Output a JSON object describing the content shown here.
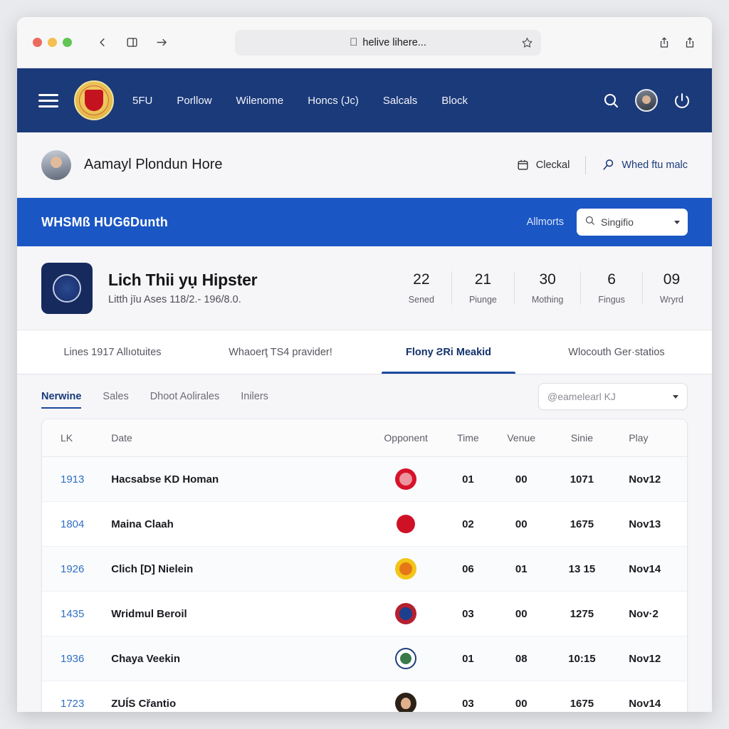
{
  "browser": {
    "url_text": "helive lihere...",
    "apple_glyph": "",
    "icons": {
      "back": "back-arrow-icon",
      "sidebar": "sidebar-toggle-icon",
      "forward": "forward-arrow-icon",
      "bookmark": "star-icon",
      "share": "share-icon",
      "tabs": "new-tab-icon"
    }
  },
  "navbar": {
    "brand": "club-crest",
    "links": [
      "5FU",
      "Porllow",
      "Wilenome",
      "Honcs (Jc)",
      "Salcals",
      "Block"
    ],
    "actions": {
      "search": "search-icon",
      "avatar": "user-avatar",
      "power": "power-icon"
    }
  },
  "profile": {
    "name": "Aamayl Plondun Hore",
    "actions": [
      {
        "label": "Cleckal",
        "icon": "calendar-icon"
      },
      {
        "label": "Whed ftu malc",
        "icon": "search-plus-icon"
      }
    ]
  },
  "bluebar": {
    "title": "WHSMß HUG6Dunth",
    "link": "Allmorts",
    "search": {
      "value": "Singifio",
      "icon": "search-icon"
    }
  },
  "hero": {
    "title": "Lich Thii yụ Hipster",
    "subtitle": "Litth jīu Ases 118/2.- 196/8.0.",
    "stats": [
      {
        "value": "22",
        "label": "Sened"
      },
      {
        "value": "21",
        "label": "Piunge"
      },
      {
        "value": "30",
        "label": "Mothing"
      },
      {
        "value": "6",
        "label": "Fingus"
      },
      {
        "value": "09",
        "label": "Wryrd"
      }
    ]
  },
  "main_tabs": [
    {
      "label": "Lines 1917 Allıotuites",
      "active": false
    },
    {
      "label": "Whaoerţ TS4 pravider!",
      "active": false
    },
    {
      "label": "Flony ƧRi Meakid",
      "active": true
    },
    {
      "label": "Wlocouth Ger·statios",
      "active": false
    }
  ],
  "sub_tabs": [
    {
      "label": "Nerwine",
      "active": true
    },
    {
      "label": "Sales",
      "active": false
    },
    {
      "label": "Dhoot Aolirales",
      "active": false
    },
    {
      "label": "Inilers",
      "active": false
    }
  ],
  "sub_select": {
    "value": "@eamelearl KJ"
  },
  "table": {
    "columns": [
      "LK",
      "Date",
      "Opponent",
      "Time",
      "Venue",
      "Sinie",
      "Play"
    ],
    "rows": [
      {
        "lk": "1913",
        "date": "Hacsabse KD Homan",
        "badge": "b1",
        "time": "01",
        "venue": "00",
        "sinie": "1071",
        "play": "Nov12"
      },
      {
        "lk": "1804",
        "date": "Maina Claah",
        "badge": "b2",
        "time": "02",
        "venue": "00",
        "sinie": "1675",
        "play": "Nov13"
      },
      {
        "lk": "1926",
        "date": "Clich [D] Nielein",
        "badge": "b3",
        "time": "06",
        "venue": "01",
        "sinie": "13 15",
        "play": "Nov14"
      },
      {
        "lk": "1435",
        "date": "Wridmul Beroil",
        "badge": "b4",
        "time": "03",
        "venue": "00",
        "sinie": "1275",
        "play": "Nov·2"
      },
      {
        "lk": "1936",
        "date": "Chaya Veekin",
        "badge": "b5",
        "time": "01",
        "venue": "08",
        "sinie": "10:15",
        "play": "Nov12"
      },
      {
        "lk": "1723",
        "date": "ZUÍS Cřantio",
        "badge": "b6",
        "time": "03",
        "venue": "00",
        "sinie": "1675",
        "play": "Nov14"
      }
    ]
  },
  "colors": {
    "navy": "#1b3a7a",
    "blue": "#1a56c4",
    "accent_link": "#2f6fc4",
    "tab_underline": "#1b4a9e"
  }
}
